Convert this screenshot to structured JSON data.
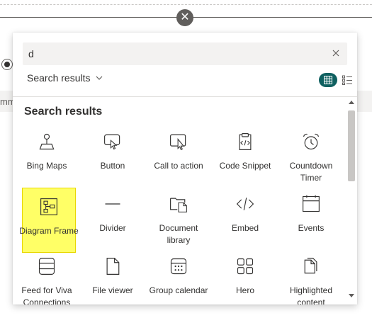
{
  "search": {
    "value": "d"
  },
  "filter": {
    "label": "Search results"
  },
  "section": {
    "title": "Search results"
  },
  "background": {
    "partial_text": "mm"
  },
  "tiles": [
    {
      "label": "Bing Maps",
      "icon": "map-pin-icon"
    },
    {
      "label": "Button",
      "icon": "button-click-icon"
    },
    {
      "label": "Call to action",
      "icon": "call-to-action-icon"
    },
    {
      "label": "Code Snippet",
      "icon": "code-snippet-icon"
    },
    {
      "label": "Countdown Timer",
      "icon": "alarm-clock-icon"
    },
    {
      "label": "Diagram Frame",
      "icon": "diagram-icon",
      "selected": true
    },
    {
      "label": "Divider",
      "icon": "divider-line-icon"
    },
    {
      "label": "Document library",
      "icon": "document-library-icon"
    },
    {
      "label": "Embed",
      "icon": "embed-code-icon"
    },
    {
      "label": "Events",
      "icon": "calendar-icon"
    },
    {
      "label": "Feed for Viva Connections",
      "icon": "feed-icon"
    },
    {
      "label": "File viewer",
      "icon": "file-icon"
    },
    {
      "label": "Group calendar",
      "icon": "group-calendar-icon"
    },
    {
      "label": "Hero",
      "icon": "hero-layout-icon"
    },
    {
      "label": "Highlighted content",
      "icon": "highlighted-content-icon"
    }
  ],
  "colors": {
    "accent": "#0f6060",
    "highlight": "#ffff66"
  }
}
